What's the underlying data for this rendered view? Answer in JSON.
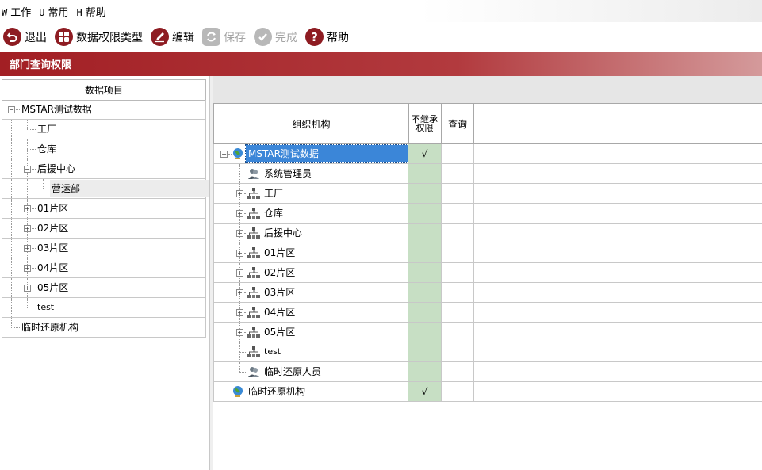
{
  "menu": [
    {
      "key": "W",
      "label": "工作"
    },
    {
      "key": "U",
      "label": "常用"
    },
    {
      "key": "H",
      "label": "帮助"
    }
  ],
  "toolbar": {
    "exit": "退出",
    "permission_type": "数据权限类型",
    "edit": "编辑",
    "save": "保存",
    "finish": "完成",
    "help": "帮助"
  },
  "title": "部门查询权限",
  "left_tree": {
    "header": "数据项目",
    "items": [
      {
        "label": "MSTAR测试数据"
      },
      {
        "label": "工厂"
      },
      {
        "label": "仓库"
      },
      {
        "label": "后援中心"
      },
      {
        "label": "营运部"
      },
      {
        "label": "01片区"
      },
      {
        "label": "02片区"
      },
      {
        "label": "03片区"
      },
      {
        "label": "04片区"
      },
      {
        "label": "05片区"
      },
      {
        "label": "test"
      },
      {
        "label": "临时还原机构"
      }
    ]
  },
  "grid": {
    "col_org": "组织机构",
    "col_inherit": "不继承权限",
    "col_query": "查询",
    "rows": [
      {
        "label": "MSTAR测试数据",
        "inherit": "√"
      },
      {
        "label": "系统管理员",
        "inherit": ""
      },
      {
        "label": "工厂",
        "inherit": ""
      },
      {
        "label": "仓库",
        "inherit": ""
      },
      {
        "label": "后援中心",
        "inherit": ""
      },
      {
        "label": "01片区",
        "inherit": ""
      },
      {
        "label": "02片区",
        "inherit": ""
      },
      {
        "label": "03片区",
        "inherit": ""
      },
      {
        "label": "04片区",
        "inherit": ""
      },
      {
        "label": "05片区",
        "inherit": ""
      },
      {
        "label": "test",
        "inherit": ""
      },
      {
        "label": "临时还原人员",
        "inherit": ""
      },
      {
        "label": "临时还原机构",
        "inherit": "√"
      }
    ]
  },
  "colors": {
    "title_bar": "#a21f24",
    "selection": "#3b86d8",
    "inherit_cell": "#c7dfc4"
  }
}
